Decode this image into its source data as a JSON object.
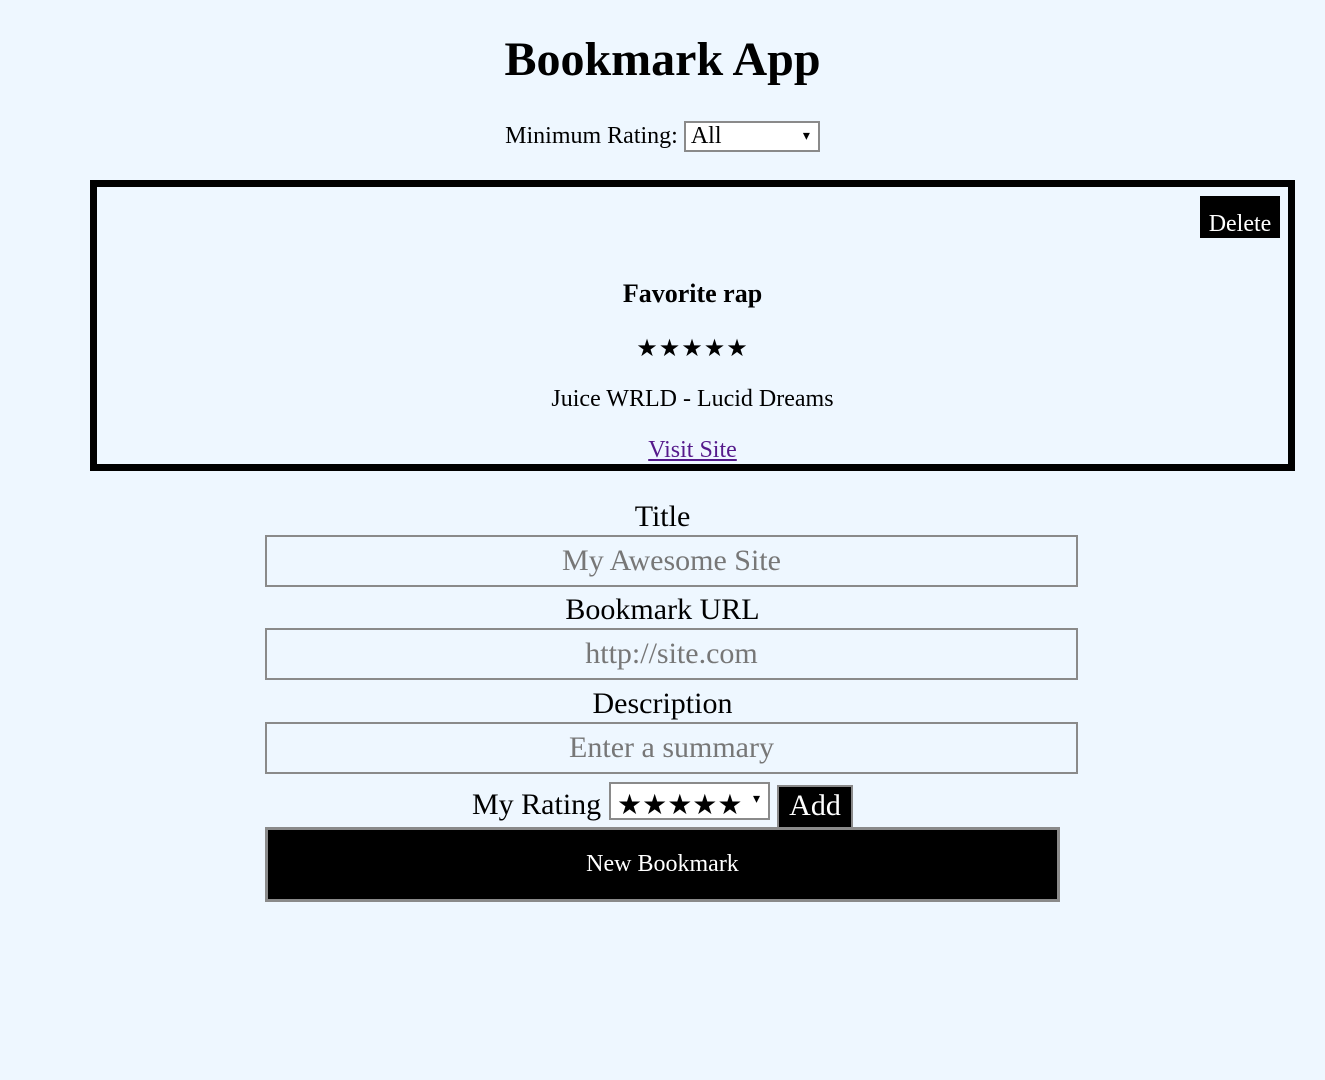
{
  "app": {
    "title": "Bookmark App"
  },
  "filter": {
    "label": "Minimum Rating:",
    "selected": "All",
    "arrow": "▾"
  },
  "bookmarks": [
    {
      "delete_label": "Delete",
      "title": "Favorite rap",
      "stars": "★★★★★",
      "rating": 5,
      "description": "Juice WRLD - Lucid Dreams",
      "link_label": "Visit Site"
    }
  ],
  "form": {
    "title_label": "Title",
    "title_placeholder": "My Awesome Site",
    "url_label": "Bookmark URL",
    "url_placeholder": "http://site.com",
    "description_label": "Description",
    "description_placeholder": "Enter a summary",
    "rating_label": "My Rating",
    "rating_selected": "★★★★★",
    "rating_arrow": "▾",
    "add_label": "Add"
  },
  "new_bookmark": {
    "label": "New Bookmark"
  },
  "colors": {
    "background": "#eef7ff",
    "button": "#000000",
    "button_text": "#ffffff",
    "link": "#551a8b",
    "border": "#8a8a8a"
  }
}
